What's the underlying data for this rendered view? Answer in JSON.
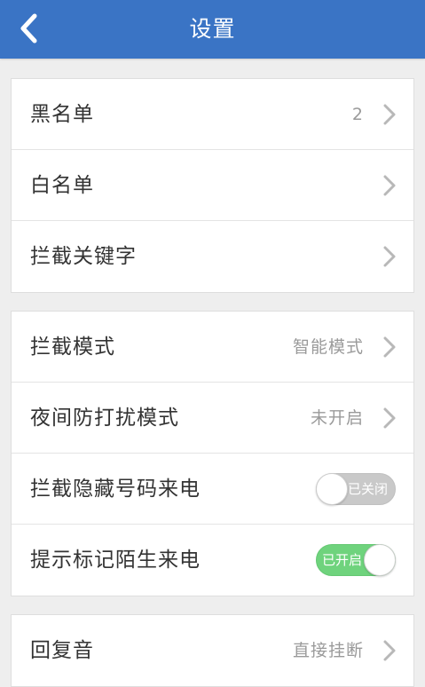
{
  "header": {
    "title": "设置",
    "back_icon": "back-chevron-icon"
  },
  "group1": {
    "items": [
      {
        "label": "黑名单",
        "value": "2"
      },
      {
        "label": "白名单",
        "value": ""
      },
      {
        "label": "拦截关键字",
        "value": ""
      }
    ]
  },
  "group2": {
    "items": [
      {
        "label": "拦截模式",
        "value": "智能模式"
      },
      {
        "label": "夜间防打扰模式",
        "value": "未开启"
      },
      {
        "label": "拦截隐藏号码来电",
        "toggle_text": "已关闭",
        "toggle_on": false
      },
      {
        "label": "提示标记陌生来电",
        "toggle_text": "已开启",
        "toggle_on": true
      }
    ]
  },
  "group3": {
    "items": [
      {
        "label": "回复音",
        "value": "直接挂断"
      }
    ]
  },
  "colors": {
    "header_bg": "#3a74c5",
    "toggle_on": "#6fd37d",
    "toggle_off": "#c9c9c9"
  }
}
